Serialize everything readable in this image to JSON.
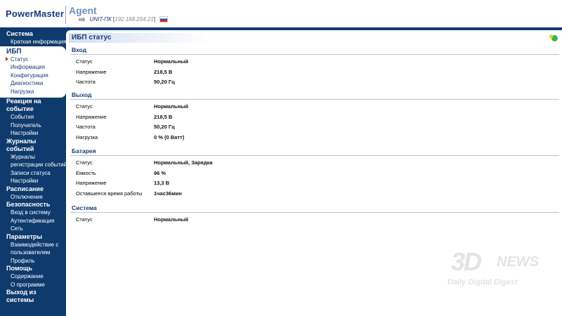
{
  "header": {
    "logo": "PowerMaster",
    "agent": "Agent",
    "on_label": "на",
    "host": "UNIT-ПК",
    "ip": "192.168.254.21",
    "ip_open": "[",
    "ip_close": "]"
  },
  "sidebar": {
    "system": {
      "label": "Система",
      "items": [
        "Краткая информация"
      ]
    },
    "ups": {
      "label": "ИБП",
      "items": [
        "Статус",
        "Информация",
        "Конфигурация",
        "Диагностика",
        "Нагрузка"
      ]
    },
    "reaction": {
      "label_1": "Реакция на",
      "label_2": "событие",
      "items": [
        "События",
        "Получатель",
        "Настройки"
      ]
    },
    "logs": {
      "label": "Журналы событий",
      "items_1": "Журналы",
      "items_2": "регистрации событий",
      "items_3": "Записи статуса",
      "items_4": "Настройки"
    },
    "schedule": {
      "label": "Расписание",
      "items": [
        "Отключение"
      ]
    },
    "security": {
      "label": "Безопасность",
      "items": [
        "Вход в систему",
        "Аутентификация",
        "Сеть"
      ]
    },
    "params": {
      "label": "Параметры",
      "item_1a": "Взаимодействие с",
      "item_1b": "пользователем",
      "item_2": "Профиль"
    },
    "help": {
      "label": "Помощь",
      "items": [
        "Содержание",
        "О программе"
      ]
    },
    "logout": "Выход из системы"
  },
  "main": {
    "title": "ИБП статус",
    "sections": {
      "input": {
        "title": "Вход",
        "rows": [
          {
            "label": "Статус",
            "value": "Нормальный"
          },
          {
            "label": "Напряжение",
            "value": "218,5 В"
          },
          {
            "label": "Частота",
            "value": "50,20 Гц"
          }
        ]
      },
      "output": {
        "title": "Выход",
        "rows": [
          {
            "label": "Статус",
            "value": "Нормальный"
          },
          {
            "label": "Напряжение",
            "value": "218,5 В"
          },
          {
            "label": "Частота",
            "value": "50,20 Гц"
          },
          {
            "label": "Нагрузка",
            "value": "0 % (0 Ватт)"
          }
        ]
      },
      "battery": {
        "title": "Батарея",
        "rows": [
          {
            "label": "Статус",
            "value": "Нормальный, Зарядка"
          },
          {
            "label": "Емкость",
            "value": "96 %"
          },
          {
            "label": "Напряжение",
            "value": "13,3 В"
          },
          {
            "label": "Оставшееся время работы",
            "value": "1час36мин"
          }
        ]
      },
      "system": {
        "title": "Система",
        "rows": [
          {
            "label": "Статус",
            "value": "Нормальный"
          }
        ]
      }
    }
  },
  "watermark": {
    "big": "3D",
    "news": "NEWS",
    "sub": "Daily Digital Digest"
  }
}
